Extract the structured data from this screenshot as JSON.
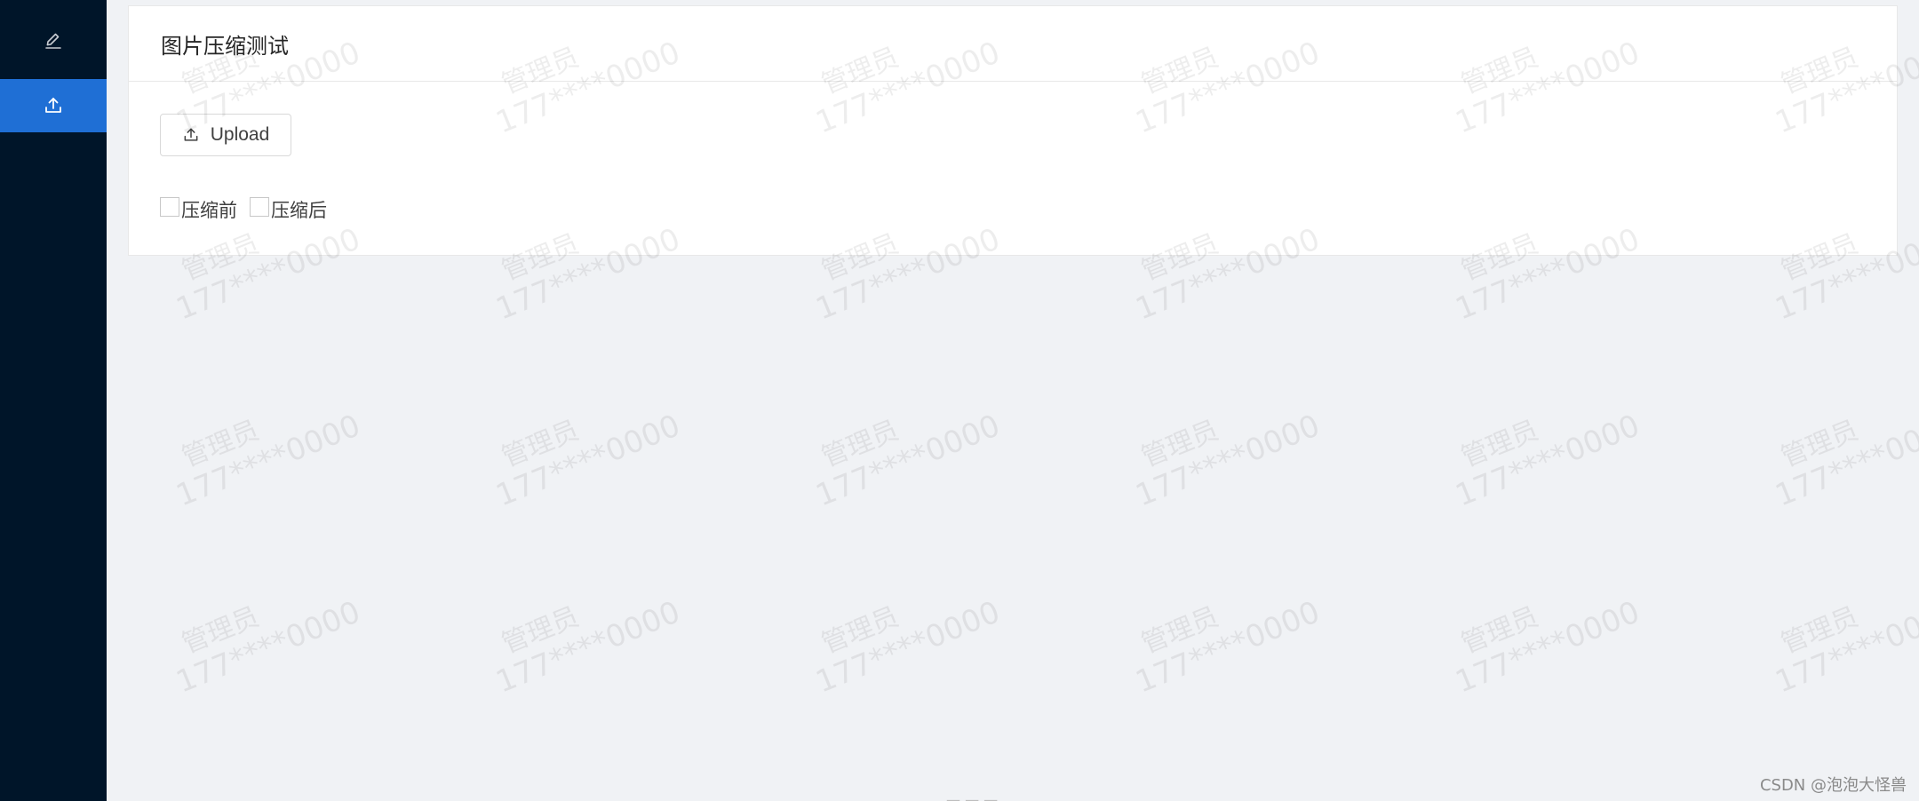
{
  "sidebar": {
    "items": [
      {
        "icon": "edit-icon"
      },
      {
        "icon": "upload-icon",
        "active": true
      }
    ],
    "bg_color": "#001529",
    "active_color": "#1f6fd5"
  },
  "card": {
    "title": "图片压缩测试",
    "upload_label": "Upload",
    "checkboxes": [
      {
        "label": "压缩前",
        "checked": false
      },
      {
        "label": "压缩后",
        "checked": false
      }
    ]
  },
  "watermark": {
    "role": "管理员",
    "phone": "177****0000"
  },
  "footer": {
    "credit": "CSDN @泡泡大怪兽"
  }
}
